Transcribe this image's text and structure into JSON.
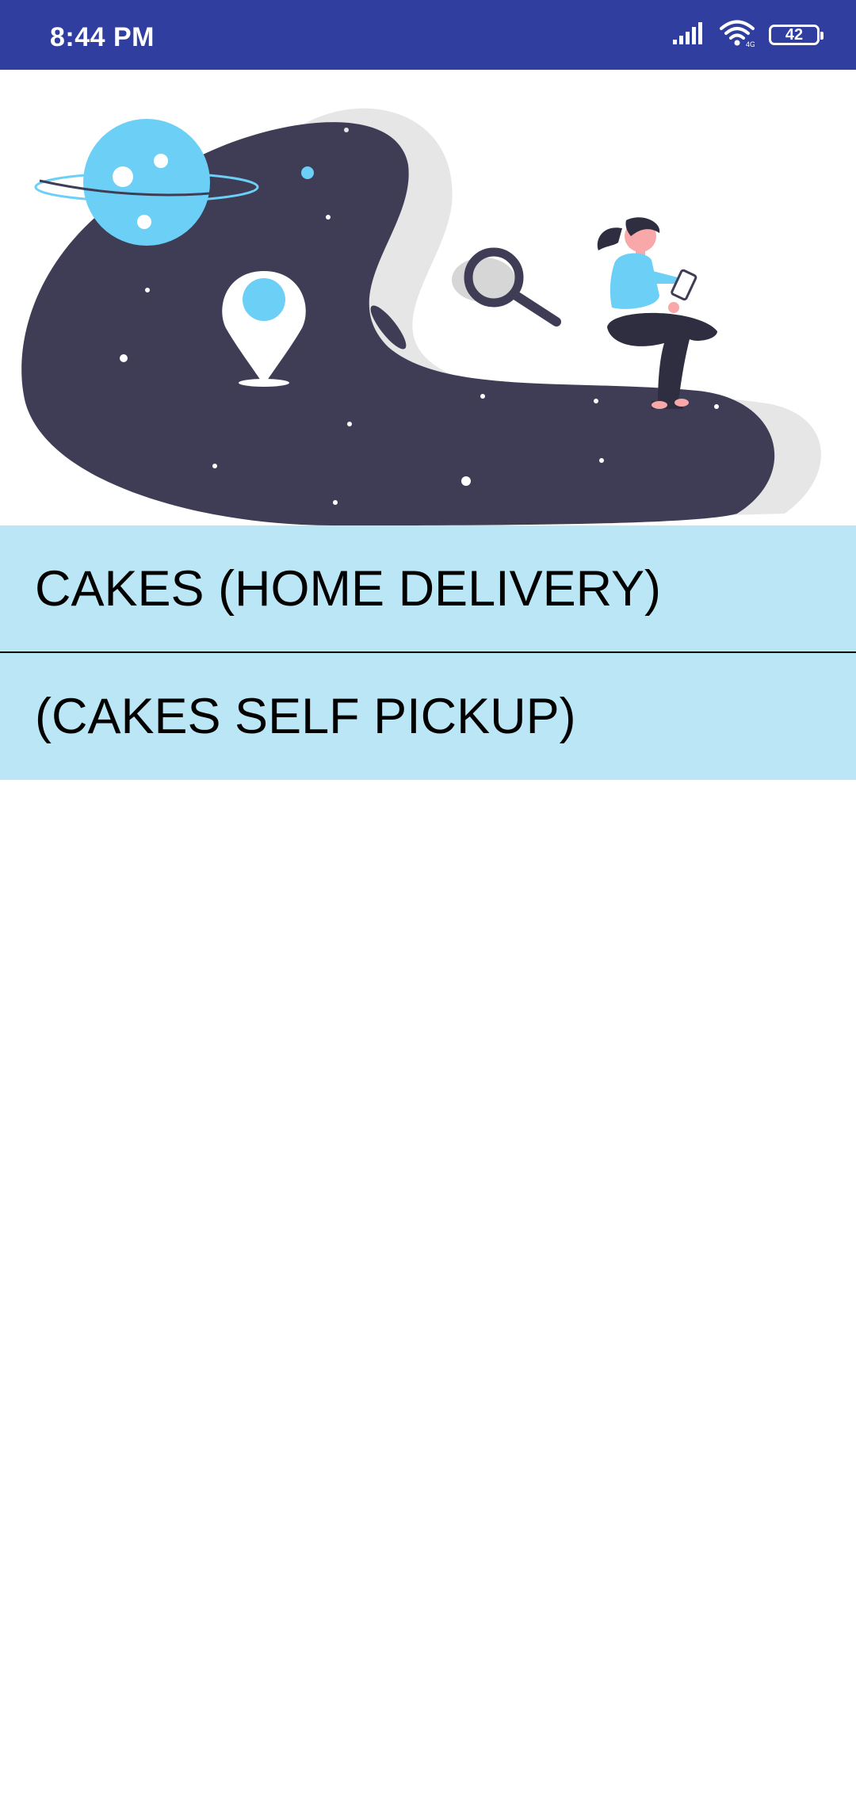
{
  "status_bar": {
    "time": "8:44 PM",
    "battery_level": "42",
    "icons": [
      "signal-icon",
      "wifi-icon",
      "battery-icon"
    ]
  },
  "hero": {
    "illustration": "location-search-illustration"
  },
  "options": [
    {
      "label": "CAKES (HOME DELIVERY)"
    },
    {
      "label": "(CAKES SELF PICKUP)"
    }
  ],
  "colors": {
    "status_bar": "#303f9f",
    "option_background": "#bbe6f6",
    "illustration_dark": "#3f3d56",
    "illustration_accent": "#6ccff6"
  }
}
